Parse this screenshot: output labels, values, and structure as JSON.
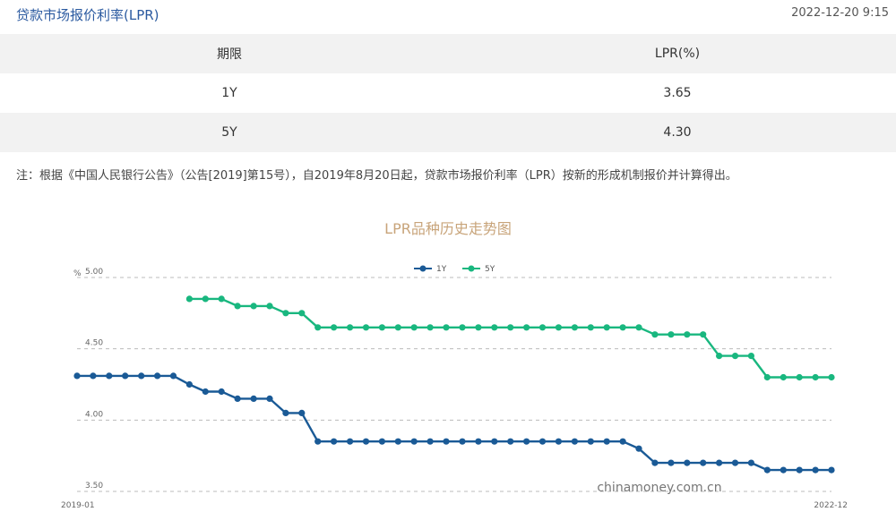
{
  "header": {
    "title": "贷款市场报价利率(LPR)",
    "datetime": "2022-12-20 9:15"
  },
  "table": {
    "columns": [
      "期限",
      "LPR(%)"
    ],
    "rows": [
      {
        "term": "1Y",
        "rate": "3.65"
      },
      {
        "term": "5Y",
        "rate": "4.30"
      }
    ]
  },
  "note": "注：根据《中国人民银行公告》（公告[2019]第15号），自2019年8月20日起，贷款市场报价利率（LPR）按新的形成机制报价并计算得出。",
  "watermark": "chinamoney.com.cn",
  "colors": {
    "series_1y": "#1a5a96",
    "series_5y": "#19b77f",
    "title": "#c8a47a",
    "header_title": "#2b5aa0"
  },
  "chart_data": {
    "type": "line",
    "title": "LPR品种历史走势图",
    "ylabel": "%",
    "ylim": [
      3.5,
      5.0
    ],
    "yticks": [
      "5.00",
      "4.50",
      "4.00",
      "3.50"
    ],
    "xtick_labels": [
      "2019-01",
      "2022-12"
    ],
    "legend_placement": "top-center",
    "grid": true,
    "x": [
      "2019-01",
      "2019-02",
      "2019-03",
      "2019-04",
      "2019-05",
      "2019-06",
      "2019-07",
      "2019-08",
      "2019-09",
      "2019-10",
      "2019-11",
      "2019-12",
      "2020-01",
      "2020-02",
      "2020-03",
      "2020-04",
      "2020-05",
      "2020-06",
      "2020-07",
      "2020-08",
      "2020-09",
      "2020-10",
      "2020-11",
      "2020-12",
      "2021-01",
      "2021-02",
      "2021-03",
      "2021-04",
      "2021-05",
      "2021-06",
      "2021-07",
      "2021-08",
      "2021-09",
      "2021-10",
      "2021-11",
      "2021-12",
      "2022-01",
      "2022-02",
      "2022-03",
      "2022-04",
      "2022-05",
      "2022-06",
      "2022-07",
      "2022-08",
      "2022-09",
      "2022-10",
      "2022-11",
      "2022-12"
    ],
    "series": [
      {
        "name": "1Y",
        "values": [
          4.31,
          4.31,
          4.31,
          4.31,
          4.31,
          4.31,
          4.31,
          4.25,
          4.2,
          4.2,
          4.15,
          4.15,
          4.15,
          4.05,
          4.05,
          3.85,
          3.85,
          3.85,
          3.85,
          3.85,
          3.85,
          3.85,
          3.85,
          3.85,
          3.85,
          3.85,
          3.85,
          3.85,
          3.85,
          3.85,
          3.85,
          3.85,
          3.85,
          3.85,
          3.85,
          3.8,
          3.7,
          3.7,
          3.7,
          3.7,
          3.7,
          3.7,
          3.7,
          3.65,
          3.65,
          3.65,
          3.65,
          3.65
        ]
      },
      {
        "name": "5Y",
        "values": [
          null,
          null,
          null,
          null,
          null,
          null,
          null,
          4.85,
          4.85,
          4.85,
          4.8,
          4.8,
          4.8,
          4.75,
          4.75,
          4.65,
          4.65,
          4.65,
          4.65,
          4.65,
          4.65,
          4.65,
          4.65,
          4.65,
          4.65,
          4.65,
          4.65,
          4.65,
          4.65,
          4.65,
          4.65,
          4.65,
          4.65,
          4.65,
          4.65,
          4.65,
          4.6,
          4.6,
          4.6,
          4.6,
          4.45,
          4.45,
          4.45,
          4.3,
          4.3,
          4.3,
          4.3,
          4.3
        ]
      }
    ]
  }
}
